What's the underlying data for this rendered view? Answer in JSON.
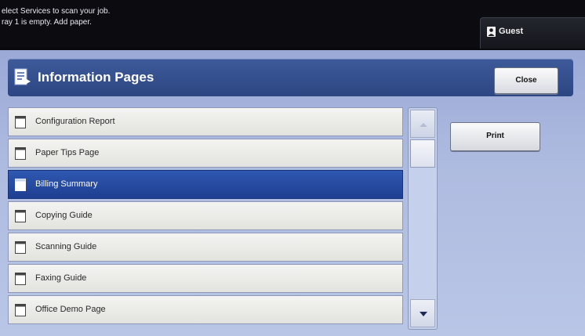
{
  "status": {
    "message_line1": "elect Services to scan your job.",
    "message_line2": "ray 1 is empty.  Add paper.",
    "user_label": "Guest"
  },
  "header": {
    "title": "Information Pages",
    "close_label": "Close"
  },
  "list": {
    "items": [
      {
        "label": "Configuration Report",
        "selected": false
      },
      {
        "label": "Paper Tips Page",
        "selected": false
      },
      {
        "label": "Billing Summary",
        "selected": true
      },
      {
        "label": "Copying Guide",
        "selected": false
      },
      {
        "label": "Scanning Guide",
        "selected": false
      },
      {
        "label": "Faxing Guide",
        "selected": false
      },
      {
        "label": "Office Demo Page",
        "selected": false
      }
    ]
  },
  "actions": {
    "print_label": "Print"
  },
  "colors": {
    "header_blue": "#2c4682",
    "selected_blue": "#1e3f92",
    "panel_bg": "#aebbe0"
  }
}
